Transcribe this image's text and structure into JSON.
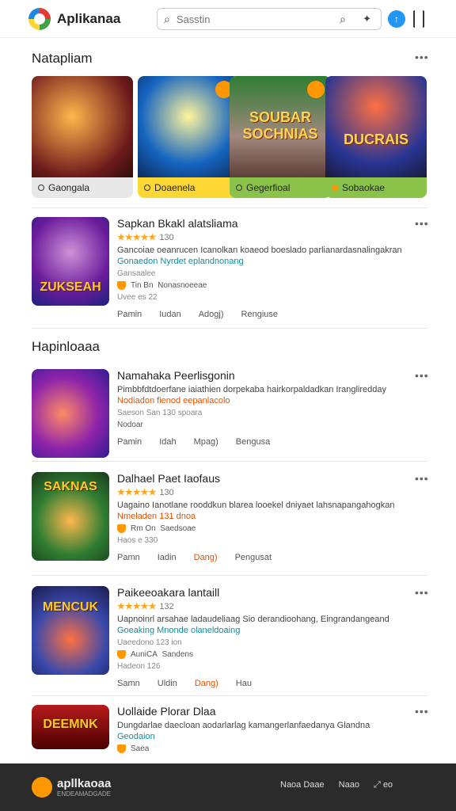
{
  "header": {
    "app_title": "Aplikanaa",
    "search_placeholder": "Sasstin"
  },
  "featured": {
    "title": "Natapliam",
    "items": [
      {
        "label": "Gaongala",
        "art_text": ""
      },
      {
        "label": "Doaenela",
        "art_text": ""
      },
      {
        "label": "Gegerfioal",
        "art_text": "SOUBAR SOCHNIAS"
      },
      {
        "label": "Sobaokae",
        "art_text": "DUCRAIS"
      }
    ]
  },
  "list1": [
    {
      "name": "Sapkan Bkakl alatsliama",
      "rating": "★★★★★",
      "rating_value": "130",
      "desc": "Gancoiae oeanrucen Icanolkan koaeod boeslado parlianardasnalingakran",
      "desc2": "Gonaedon Nyrdet eplandnonang",
      "meta": "Gansaalee",
      "dev": "Tin Bn",
      "dev2": "Nonasnoeeae",
      "size": "Uvee es 22",
      "actions": [
        "Pamin",
        "Iudan",
        "Adogj)",
        "Rengiuse"
      ],
      "thumb_text": "ZUKSEAH"
    }
  ],
  "second": {
    "title": "Hapinloaaa"
  },
  "list2": [
    {
      "name": "Namahaka Peerlisgonin",
      "rating": "",
      "rating_value": "",
      "desc": "Pimbbfdtdoerfane iaiathien dorpekaba hairkorpaldadkan Irangliredday",
      "desc2": "Nodiadon fienod eepanlacolo",
      "meta": "Saeson San 130 spoara",
      "dev": "Nodoar",
      "dev2": "",
      "size": "",
      "actions": [
        "Pamin",
        "Idah",
        "Mpag)",
        "Bengusa"
      ],
      "thumb_text": ""
    },
    {
      "name": "Dalhael Paet Iaofaus",
      "rating": "★★★★★",
      "rating_value": "130",
      "desc": "Uagaino Ianotlane rooddkun blarea looekel dniyaet lahsnapangahogkan",
      "desc2": "Nmeladen 131 dnoa",
      "meta": "",
      "dev": "Rm On",
      "dev2": "Saedsoae",
      "size": "Haos e 330",
      "actions": [
        "Pamn",
        "Iadin",
        "Dang)",
        "Pengusat"
      ],
      "thumb_text": "SAKNAS"
    },
    {
      "name": "Paikeeoakara lantaill",
      "rating": "★★★★★",
      "rating_value": "132",
      "desc": "Uapnoinrl arsahae ladaudeliaag Sio derandioohang, Eingrandangeand",
      "desc2": "Goeaking Mnonde olaneldoaing",
      "meta": "Uaeedono 123 ion",
      "dev": "AuniCA",
      "dev2": "Sandens",
      "size": "Hadeon 126",
      "actions": [
        "Samn",
        "Uldin",
        "Dang)",
        "Hau"
      ],
      "thumb_text": "MENCUK"
    },
    {
      "name": "Uollaide Plorar Dlaa",
      "rating": "",
      "rating_value": "",
      "desc": "Dungdarlae daecloan aodarlarlag kamangerlanfaedanya Glandna",
      "desc2": "Geodaion",
      "meta": "",
      "dev": "Saea",
      "dev2": "",
      "size": "",
      "actions": [],
      "thumb_text": "DEEMNK"
    }
  ],
  "footer": {
    "name": "apllkaoaa",
    "sub": "ENDEAMADGADE",
    "links": [
      "Naoa Daae",
      "Naao",
      "eo"
    ]
  }
}
